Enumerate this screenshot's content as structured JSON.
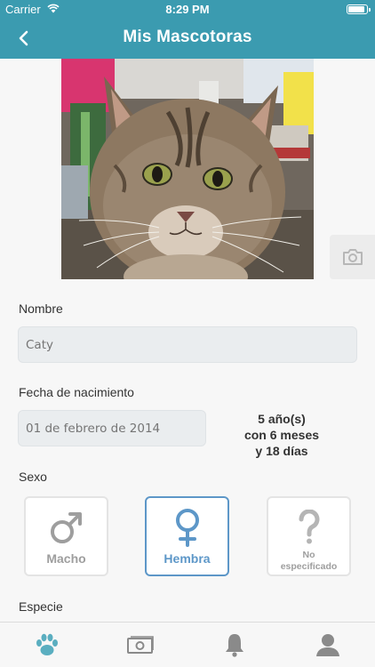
{
  "status_bar": {
    "carrier": "Carrier",
    "time": "8:29 PM",
    "battery_level": 0.95
  },
  "nav": {
    "title": "Mis Mascotoras",
    "back_icon": "chevron-left-icon"
  },
  "photo": {
    "description_icon": "pet-photo",
    "camera_icon": "camera-icon"
  },
  "form": {
    "name_label": "Nombre",
    "name_value": "Caty",
    "birth_label": "Fecha de nacimiento",
    "birth_value": "01 de febrero de 2014",
    "age_line1": "5 año(s)",
    "age_line2": "con 6 meses",
    "age_line3": "y 18 días",
    "sex_label": "Sexo",
    "sex_options": [
      {
        "label": "Macho",
        "icon": "male-icon",
        "selected": false
      },
      {
        "label": "Hembra",
        "icon": "female-icon",
        "selected": true
      },
      {
        "label_line1": "No",
        "label_line2": "especificado",
        "icon": "question-icon",
        "selected": false
      }
    ],
    "species_label": "Especie"
  },
  "tabbar": {
    "tabs": [
      {
        "icon": "paw-icon",
        "active": true
      },
      {
        "icon": "money-icon",
        "active": false
      },
      {
        "icon": "bell-icon",
        "active": false
      },
      {
        "icon": "user-icon",
        "active": false
      }
    ]
  },
  "colors": {
    "header": "#3b9bb0",
    "selected_border": "#5d97c8",
    "tab_active": "#5aaec0",
    "tab_inactive": "#8a8a8a"
  }
}
